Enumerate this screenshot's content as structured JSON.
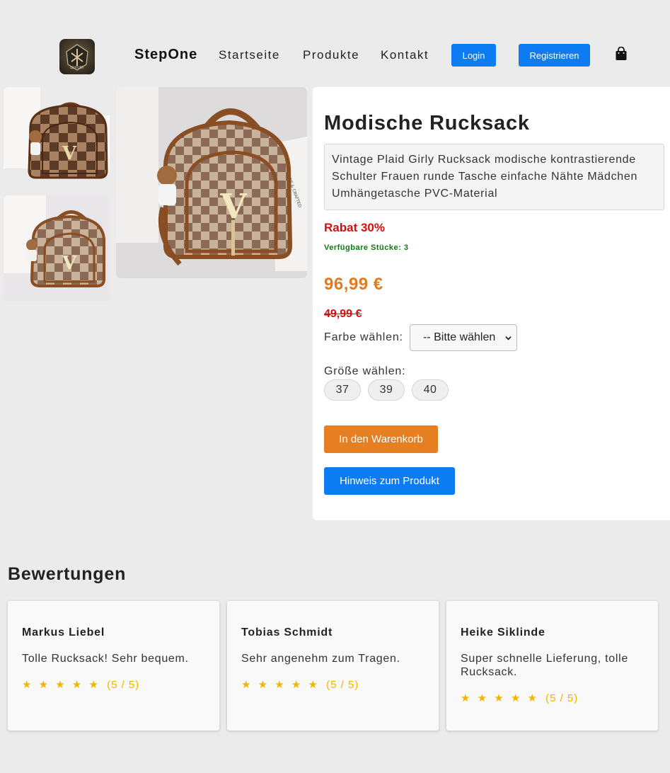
{
  "header": {
    "brand": "StepOne",
    "nav": [
      "Startseite",
      "Produkte",
      "Kontakt"
    ],
    "login_label": "Login",
    "register_label": "Registrieren",
    "logo_text": "LUXURY"
  },
  "product": {
    "title": "Modische Rucksack",
    "description": "Vintage Plaid Girly Rucksack modische kontrastierende Schulter Frauen runde Tasche einfache Nähte Mädchen Umhängetasche PVC-Material",
    "discount": "Rabat 30%",
    "stock": "Verfügbare Stücke: 3",
    "price": "96,99 €",
    "old_price": "49,99 €",
    "color_label": "Farbe wählen:",
    "color_select_value": "-- Bitte wählen",
    "size_label": "Größe wählen:",
    "sizes": [
      "37",
      "39",
      "40"
    ],
    "add_to_cart_label": "In den Warenkorb",
    "hint_label": "Hinweis zum Produkt",
    "image_text": "MADE & CRAFTED"
  },
  "reviews": {
    "title": "Bewertungen",
    "items": [
      {
        "name": "Markus Liebel",
        "text": "Tolle Rucksack! Sehr bequem.",
        "stars": "★ ★ ★ ★ ★",
        "score": "(5 / 5)"
      },
      {
        "name": "Tobias Schmidt",
        "text": "Sehr angenehm zum Tragen.",
        "stars": "★ ★ ★ ★ ★",
        "score": "(5 / 5)"
      },
      {
        "name": "Heike Siklinde",
        "text": "Super schnelle Lieferung, tolle Rucksack.",
        "stars": "★ ★ ★ ★ ★",
        "score": "(5 / 5)"
      }
    ]
  },
  "colors": {
    "primary_blue": "#0d7cf2",
    "orange": "#e57f22",
    "price_orange": "#e07b20",
    "discount_red": "#d0100f",
    "stock_green": "#0d7a12",
    "star_yellow": "#f2b400",
    "background": "#ebebeb"
  }
}
